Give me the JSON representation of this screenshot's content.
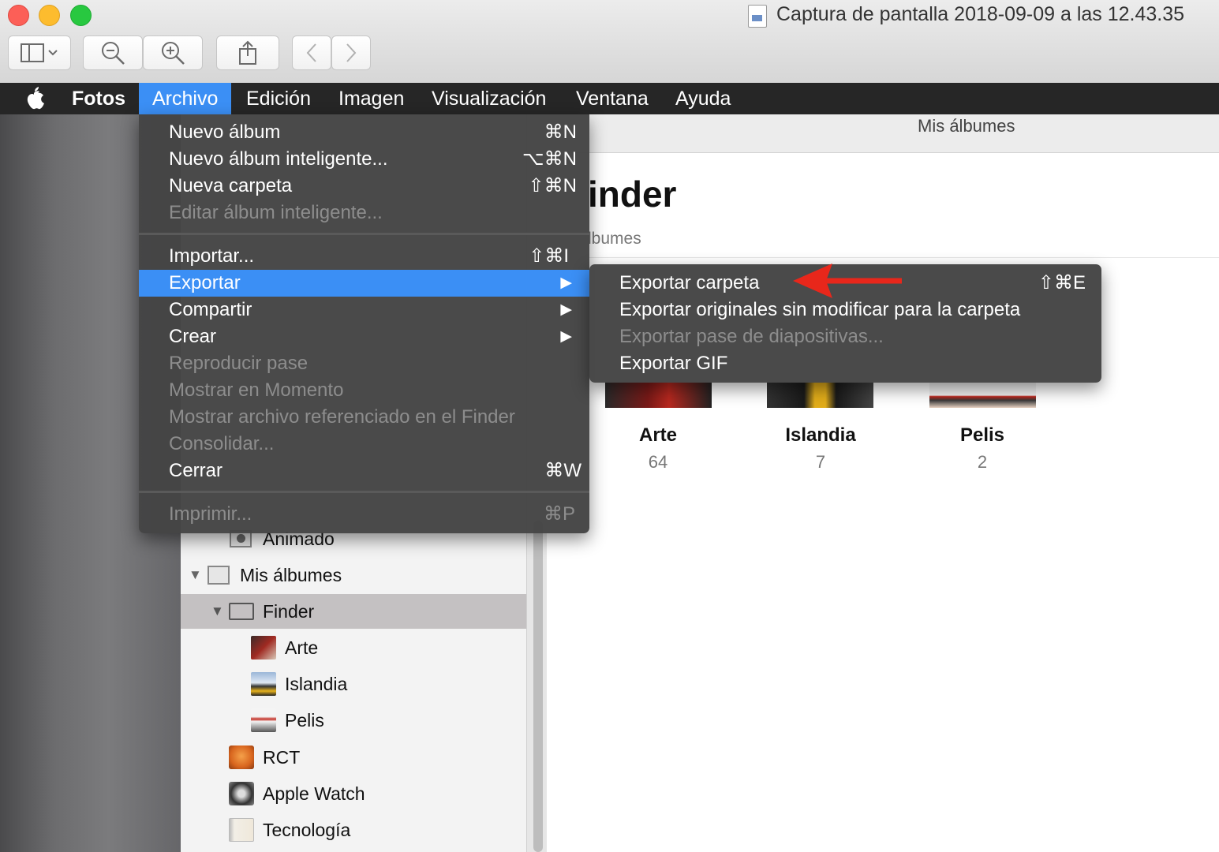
{
  "window": {
    "title": "Captura de pantalla 2018-09-09 a las 12.43.35"
  },
  "toolbar": {
    "sidebar_toggle_icon": "sidebar-icon",
    "zoom_out_icon": "zoom-out-icon",
    "zoom_in_icon": "zoom-in-icon",
    "share_icon": "share-icon",
    "back_icon": "chevron-left-icon",
    "forward_icon": "chevron-right-icon"
  },
  "menubar": {
    "apple_icon": "apple-icon",
    "app_name": "Fotos",
    "items": [
      "Archivo",
      "Edición",
      "Imagen",
      "Visualización",
      "Ventana",
      "Ayuda"
    ],
    "active": "Archivo"
  },
  "archivo_menu": {
    "items": [
      {
        "label": "Nuevo álbum",
        "shortcut": "⌘N",
        "enabled": true
      },
      {
        "label": "Nuevo álbum inteligente...",
        "shortcut": "⌥⌘N",
        "enabled": true
      },
      {
        "label": "Nueva carpeta",
        "shortcut": "⇧⌘N",
        "enabled": true
      },
      {
        "label": "Editar álbum inteligente...",
        "shortcut": "",
        "enabled": false
      },
      {
        "label": "Importar...",
        "shortcut": "⇧⌘I",
        "enabled": true
      },
      {
        "label": "Exportar",
        "shortcut": "",
        "enabled": true,
        "submenu": true,
        "highlighted": true
      },
      {
        "label": "Compartir",
        "shortcut": "",
        "enabled": true,
        "submenu": true
      },
      {
        "label": "Crear",
        "shortcut": "",
        "enabled": true,
        "submenu": true
      },
      {
        "label": "Reproducir pase",
        "shortcut": "",
        "enabled": false
      },
      {
        "label": "Mostrar en Momento",
        "shortcut": "",
        "enabled": false
      },
      {
        "label": "Mostrar archivo referenciado en el Finder",
        "shortcut": "",
        "enabled": false
      },
      {
        "label": "Consolidar...",
        "shortcut": "",
        "enabled": false
      },
      {
        "label": "Cerrar",
        "shortcut": "⌘W",
        "enabled": true
      },
      {
        "label": "Imprimir...",
        "shortcut": "⌘P",
        "enabled": false
      }
    ]
  },
  "export_submenu": {
    "items": [
      {
        "label": "Exportar carpeta",
        "shortcut": "⇧⌘E",
        "enabled": true
      },
      {
        "label": "Exportar originales sin modificar para la carpeta",
        "shortcut": "",
        "enabled": true
      },
      {
        "label": "Exportar pase de diapositivas...",
        "shortcut": "",
        "enabled": false
      },
      {
        "label": "Exportar GIF",
        "shortcut": "",
        "enabled": true
      }
    ]
  },
  "sidebar": {
    "items": [
      {
        "label": "Animado",
        "icon": "animated-album-icon"
      },
      {
        "label": "Mis álbumes",
        "icon": "albums-folder-icon"
      },
      {
        "label": "Finder",
        "icon": "folder-icon",
        "selected": true
      },
      {
        "label": "Arte",
        "icon": "album-thumbnail-arte"
      },
      {
        "label": "Islandia",
        "icon": "album-thumbnail-islandia"
      },
      {
        "label": "Pelis",
        "icon": "album-thumbnail-pelis"
      },
      {
        "label": "RCT",
        "icon": "album-thumbnail-rct"
      },
      {
        "label": "Apple Watch",
        "icon": "album-thumbnail-applewatch"
      },
      {
        "label": "Tecnología",
        "icon": "album-thumbnail-tecnologia"
      }
    ]
  },
  "main": {
    "header_title": "Mis álbumes",
    "title_visible": "inder",
    "subtitle_visible": "lbumes",
    "albums": [
      {
        "name": "Arte",
        "count": "64"
      },
      {
        "name": "Islandia",
        "count": "7"
      },
      {
        "name": "Pelis",
        "count": "2"
      }
    ]
  },
  "colors": {
    "highlight": "#3b8ff5",
    "menu_bg": "#444444",
    "menubar_bg": "#262626",
    "annotation_arrow": "#e8271b"
  }
}
